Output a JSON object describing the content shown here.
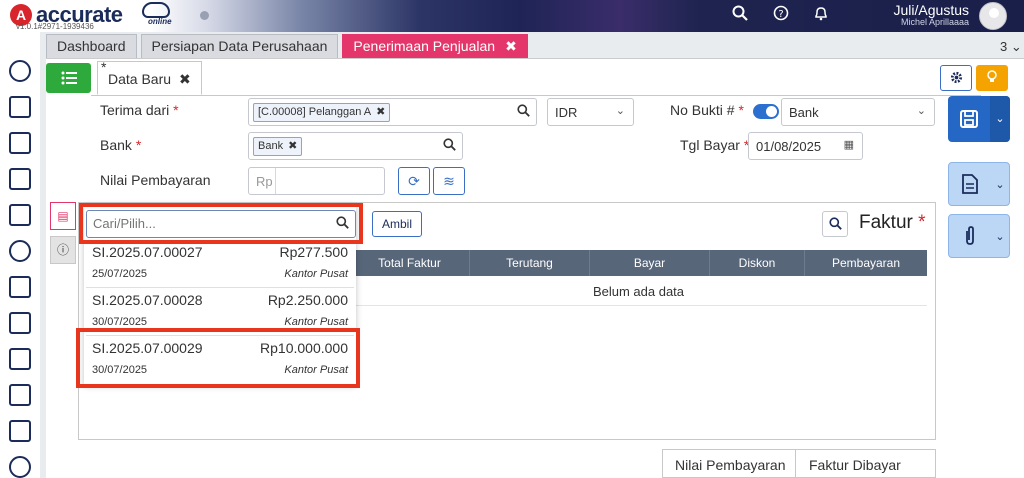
{
  "app": {
    "brand": "accurate",
    "brand_sub": "online",
    "version": "v1.0.1#2971-1939436",
    "period": "Juli/Agustus",
    "user": "Michel Aprillaaaa"
  },
  "tabs": [
    {
      "label": "Dashboard"
    },
    {
      "label": "Persiapan Data Perusahaan"
    },
    {
      "label": "Penerimaan Penjualan",
      "close": "✖"
    }
  ],
  "tab_count": "3",
  "subtab": {
    "label": "Data Baru",
    "star": "*",
    "close": "✖"
  },
  "form": {
    "terima_dari_label": "Terima dari",
    "terima_dari_value": "[C.00008] Pelanggan A",
    "currency": "IDR",
    "no_bukti_label": "No Bukti #",
    "no_bukti_value": "Bank",
    "bank_label": "Bank",
    "bank_value": "Bank",
    "tgl_bayar_label": "Tgl Bayar",
    "tgl_bayar_value": "01/08/2025",
    "nilai_label": "Nilai Pembayaran",
    "nilai_prefix": "Rp",
    "required_mark": "*"
  },
  "detail": {
    "ambil_label": "Ambil",
    "faktur_title": "Faktur",
    "columns": [
      "Total Faktur",
      "Terutang",
      "Bayar",
      "Diskon",
      "Pembayaran"
    ],
    "empty_text": "Belum ada data"
  },
  "dropdown": {
    "placeholder": "Cari/Pilih...",
    "items": [
      {
        "number": "SI.2025.07.00027",
        "amount": "Rp277.500",
        "date": "25/07/2025",
        "branch": "Kantor Pusat"
      },
      {
        "number": "SI.2025.07.00028",
        "amount": "Rp2.250.000",
        "date": "30/07/2025",
        "branch": "Kantor Pusat"
      },
      {
        "number": "SI.2025.07.00029",
        "amount": "Rp10.000.000",
        "date": "30/07/2025",
        "branch": "Kantor Pusat"
      }
    ]
  },
  "footer": {
    "nilai_pembayaran": "Nilai Pembayaran",
    "faktur_dibayar": "Faktur Dibayar"
  },
  "colors": {
    "accent_pink": "#e4366a",
    "brand_navy": "#1b2c5a",
    "highlight_red": "#e8361e",
    "green": "#2eaa3c",
    "orange": "#f5a300",
    "blue": "#2b6fcf"
  }
}
